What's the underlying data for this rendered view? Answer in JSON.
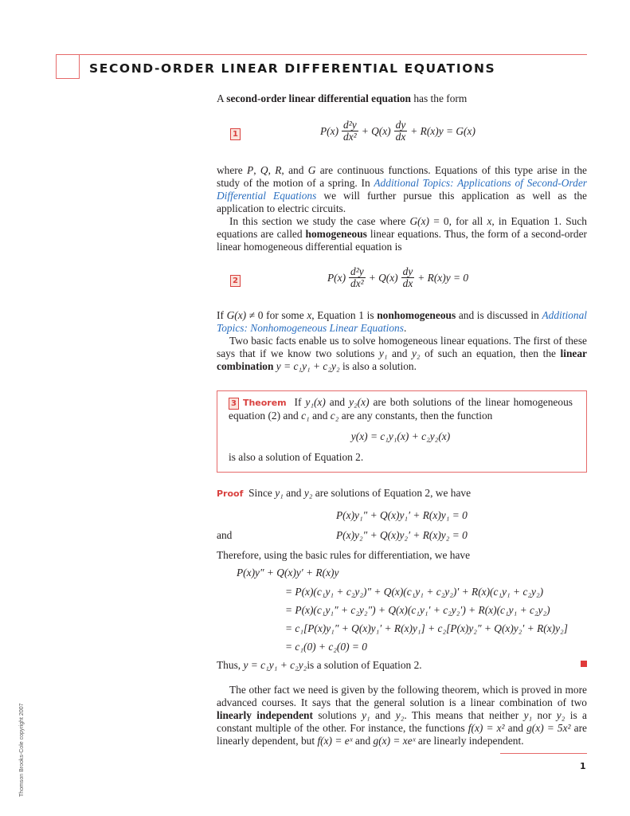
{
  "header": {
    "title": "SECOND-ORDER LINEAR DIFFERENTIAL EQUATIONS"
  },
  "intro": {
    "prefix": "A ",
    "bold": "second-order linear differential equation",
    "suffix": " has the form"
  },
  "eq1": {
    "number": "1",
    "P": "P(x)",
    "d2y": "d²y",
    "dx2": "dx²",
    "Q": "+ Q(x)",
    "dy": "dy",
    "dx": "dx",
    "rest": "+ R(x)y = G(x)"
  },
  "para1": {
    "t1": "where ",
    "t2": "P",
    "t3": ", ",
    "t4": "Q",
    "t5": ", ",
    "t6": "R",
    "t7": ", and ",
    "t8": "G",
    "t9": " are continuous functions. Equations of this type arise in the study of the motion of a spring. In ",
    "link": "Additional Topics: Applications of Second-Order Differential Equations",
    "t10": " we will further pursue this application as well as the application to electric circuits."
  },
  "para2": {
    "t1": "In this section we study the case where ",
    "t2": "G(x)",
    "t3": " = 0, for all ",
    "t4": "x",
    "t5": ", in Equation 1. Such equations are called ",
    "bold": "homogeneous",
    "t6": " linear equations. Thus, the form of a second-order linear homogeneous differential equation is"
  },
  "eq2": {
    "number": "2",
    "P": "P(x)",
    "d2y": "d²y",
    "dx2": "dx²",
    "Q": "+ Q(x)",
    "dy": "dy",
    "dx": "dx",
    "rest": "+ R(x)y = 0"
  },
  "para3": {
    "t1": "If ",
    "t2": "G(x)",
    "t3": " ≠ 0 for some ",
    "t4": "x",
    "t5": ", Equation 1 is ",
    "bold": "nonhomogeneous",
    "t6": " and is discussed in ",
    "link": "Additional Topics: Nonhomogeneous Linear Equations",
    "t7": "."
  },
  "para4": {
    "t1": "Two basic facts enable us to solve homogeneous linear equations. The first of these says that if we know two solutions ",
    "y1": "y₁",
    "t2": " and ",
    "y2": "y₂",
    "t3": " of such an equation, then the ",
    "bold": "linear combination",
    "t4": " ",
    "formula": "y = c₁y₁ + c₂y₂",
    "t5": " is also a solution."
  },
  "theorem": {
    "number": "3",
    "label": "Theorem",
    "t1": "If ",
    "f1": "y₁(x)",
    "t2": " and ",
    "f2": "y₂(x)",
    "t3": " are both solutions of the linear homogeneous equation (2) and ",
    "c1": "c₁",
    "t4": " and ",
    "c2": "c₂",
    "t5": " are any constants, then the function",
    "formula": "y(x) = c₁y₁(x) + c₂y₂(x)",
    "conclusion": "is also a solution of Equation 2."
  },
  "proof": {
    "label": "Proof",
    "t1": "Since ",
    "y1": "y₁",
    "t2": " and ",
    "y2": "y₂",
    "t3": " are solutions of Equation 2, we have",
    "eqA": "P(x)y₁″ + Q(x)y₁′ + R(x)y₁ = 0",
    "and": "and",
    "eqB": "P(x)y₂″ + Q(x)y₂′ + R(x)y₂ = 0",
    "therefore": "Therefore, using the basic rules for differentiation, we have",
    "lhs": "P(x)y″ + Q(x)y′ + R(x)y",
    "steps": [
      "= P(x)(c₁y₁ + c₂y₂)″ + Q(x)(c₁y₁ + c₂y₂)′ + R(x)(c₁y₁ + c₂y₂)",
      "= P(x)(c₁y₁″ + c₂y₂″) + Q(x)(c₁y₁′ + c₂y₂′) + R(x)(c₁y₁ + c₂y₂)",
      "= c₁[P(x)y₁″ + Q(x)y₁′ + R(x)y₁] + c₂[P(x)y₂″ + Q(x)y₂′ + R(x)y₂]",
      "= c₁(0) + c₂(0) = 0"
    ],
    "thus1": "Thus, ",
    "thus_formula": "y = c₁y₁ + c₂y₂",
    "thus2": " is a solution of Equation 2."
  },
  "para5": {
    "t1": "The other fact we need is given by the following theorem, which is proved in more advanced courses. It says that the general solution is a linear combination of two ",
    "bold": "linearly independent",
    "t2": " solutions ",
    "y1": "y₁",
    "t3": " and ",
    "y2": "y₂",
    "t4": ". This means that neither ",
    "y1b": "y₁",
    "t5": " nor ",
    "y2b": "y₂",
    "t6": " is a constant multiple of the other. For instance, the functions ",
    "f1": "f(x) = x²",
    "t7": " and ",
    "g1": "g(x) = 5x²",
    "t8": " are linearly dependent, but ",
    "f2": "f(x) = eˣ",
    "t9": " and ",
    "g2": "g(x) = xeˣ",
    "t10": " are linearly independent."
  },
  "footer": {
    "page_number": "1",
    "copyright": "Thomson Brooks-Cole copyright 2007"
  },
  "colors": {
    "accent_red": "#d9413f",
    "rule_red": "#e66a6a",
    "link_blue": "#2a6ebf"
  }
}
